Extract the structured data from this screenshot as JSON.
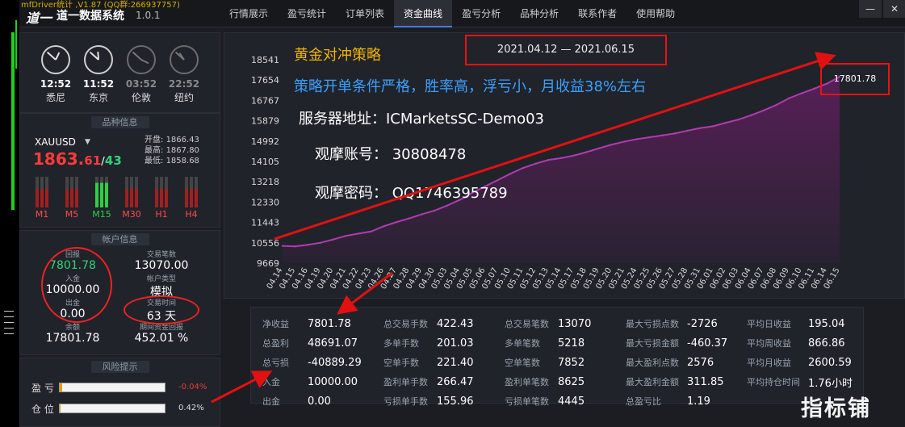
{
  "window": {
    "overlay_title": "mfDriver统计 ,V1.87 (QQ群:266937757)",
    "logo": "道一",
    "app_name": "道一数据系统",
    "version": "1.0.1",
    "minimize": "—",
    "close": "✕"
  },
  "tabs": [
    {
      "label": "行情展示"
    },
    {
      "label": "盈亏统计"
    },
    {
      "label": "订单列表"
    },
    {
      "label": "资金曲线",
      "active": true
    },
    {
      "label": "盈亏分析"
    },
    {
      "label": "品种分析"
    },
    {
      "label": "联系作者"
    },
    {
      "label": "使用帮助"
    }
  ],
  "clocks": [
    {
      "time": "12:52",
      "city": "悉尼",
      "dim": false
    },
    {
      "time": "11:52",
      "city": "东京",
      "dim": false
    },
    {
      "time": "03:52",
      "city": "伦敦",
      "dim": true
    },
    {
      "time": "22:52",
      "city": "纽约",
      "dim": true
    }
  ],
  "symbol": {
    "section_title": "品种信息",
    "name": "XAUUSD",
    "price_int": "1863.",
    "price_dec": "61",
    "sep": "/",
    "spread": "43",
    "open_label": "开盘:",
    "open": "1866.43",
    "high_label": "最高:",
    "high": "1867.80",
    "low_label": "最低:",
    "low": "1858.68",
    "timeframes": [
      "M1",
      "M5",
      "M15",
      "M30",
      "H1",
      "H4"
    ],
    "tf_green": [
      "M15"
    ]
  },
  "account": {
    "section_title": "帐户信息",
    "profit_label": "回报",
    "profit": "7801.78",
    "deposit_label": "入金",
    "deposit": "10000.00",
    "withdraw_label": "出金",
    "withdraw": "0.00",
    "balance_label": "余额",
    "balance": "17801.78",
    "trades_label": "交易笔数",
    "trades": "13070.00",
    "type_label": "帐户类型",
    "type": "模拟",
    "period_label": "交易时间",
    "period": "63 天",
    "return_label": "期间资金回报",
    "return": "452.01 %"
  },
  "risk": {
    "section_title": "风险提示",
    "pnl_label": "盈 亏",
    "pnl_value": "-0.04%",
    "pnl_fill": 0.02,
    "pos_label": "仓 位",
    "pos_value": "0.42%",
    "pos_fill": 0.004,
    "pnl_color": "#e83b3b",
    "pos_color": "#dddddd"
  },
  "overlay": {
    "title": "黄金对冲策略",
    "desc": "策略开单条件严格，胜率高，浮亏小，月收益38%左右",
    "server": "服务器地址：ICMarketsSC-Demo03",
    "account": "观摩账号：  30808478",
    "password": "观摩密码：  QQ1746395789",
    "date_range": "2021.04.12 — 2021.06.15",
    "last_value": "17801.78"
  },
  "chart_data": {
    "type": "area",
    "yticks": [
      9669,
      10556,
      11443,
      12330,
      13218,
      14105,
      14992,
      15879,
      16767,
      17654,
      18541
    ],
    "ylim": [
      9669,
      18541
    ],
    "x": [
      "04.14",
      "04.15",
      "04.16",
      "04.19",
      "04.20",
      "04.21",
      "04.22",
      "04.23",
      "04.26",
      "04.27",
      "04.28",
      "04.29",
      "04.30",
      "05.03",
      "05.04",
      "05.05",
      "05.06",
      "05.07",
      "05.10",
      "05.11",
      "05.12",
      "05.13",
      "05.14",
      "05.17",
      "05.18",
      "05.19",
      "05.20",
      "05.21",
      "05.24",
      "05.25",
      "05.26",
      "05.27",
      "05.28",
      "05.31",
      "06.01",
      "06.02",
      "06.03",
      "06.04",
      "06.07",
      "06.08",
      "06.09",
      "06.10",
      "06.11",
      "06.14",
      "06.15"
    ],
    "values": [
      10420,
      10400,
      10470,
      10560,
      10700,
      10860,
      10960,
      11050,
      11280,
      11460,
      11620,
      11800,
      11960,
      12180,
      12430,
      12740,
      13020,
      13290,
      13570,
      13820,
      14010,
      14170,
      14250,
      14360,
      14510,
      14680,
      14840,
      14970,
      15080,
      15160,
      15240,
      15330,
      15450,
      15560,
      15640,
      15790,
      15930,
      16120,
      16330,
      16570,
      16860,
      17080,
      17280,
      17500,
      17801.78
    ],
    "line_color": "#b23ab0",
    "fill_color": "#5a1f5a",
    "grid": false
  },
  "stats": [
    [
      [
        "净收益",
        "7801.78"
      ],
      [
        "总盈利",
        "48691.07"
      ],
      [
        "总亏损",
        "-40889.29"
      ],
      [
        "入金",
        "10000.00"
      ],
      [
        "出金",
        "0.00"
      ]
    ],
    [
      [
        "总交易手数",
        "422.43"
      ],
      [
        "多单手数",
        "201.03"
      ],
      [
        "空单手数",
        "221.40"
      ],
      [
        "盈利单手数",
        "266.47"
      ],
      [
        "亏损单手数",
        "155.96"
      ]
    ],
    [
      [
        "总交易笔数",
        "13070"
      ],
      [
        "多单笔数",
        "5218"
      ],
      [
        "空单笔数",
        "7852"
      ],
      [
        "盈利单笔数",
        "8625"
      ],
      [
        "亏损单笔数",
        "4445"
      ]
    ],
    [
      [
        "最大亏损点数",
        "-2726"
      ],
      [
        "最大亏损金额",
        "-460.37"
      ],
      [
        "最大盈利点数",
        "2576"
      ],
      [
        "最大盈利金额",
        "311.85"
      ],
      [
        "总盈亏比",
        "1.19"
      ]
    ],
    [
      [
        "平均日收益",
        "195.04"
      ],
      [
        "平均周收益",
        "866.86"
      ],
      [
        "平均月收益",
        "2600.59"
      ],
      [
        "平均持仓时间",
        "1.76小时"
      ]
    ]
  ],
  "watermark": "指标铺",
  "annotation_color": "#e11111"
}
